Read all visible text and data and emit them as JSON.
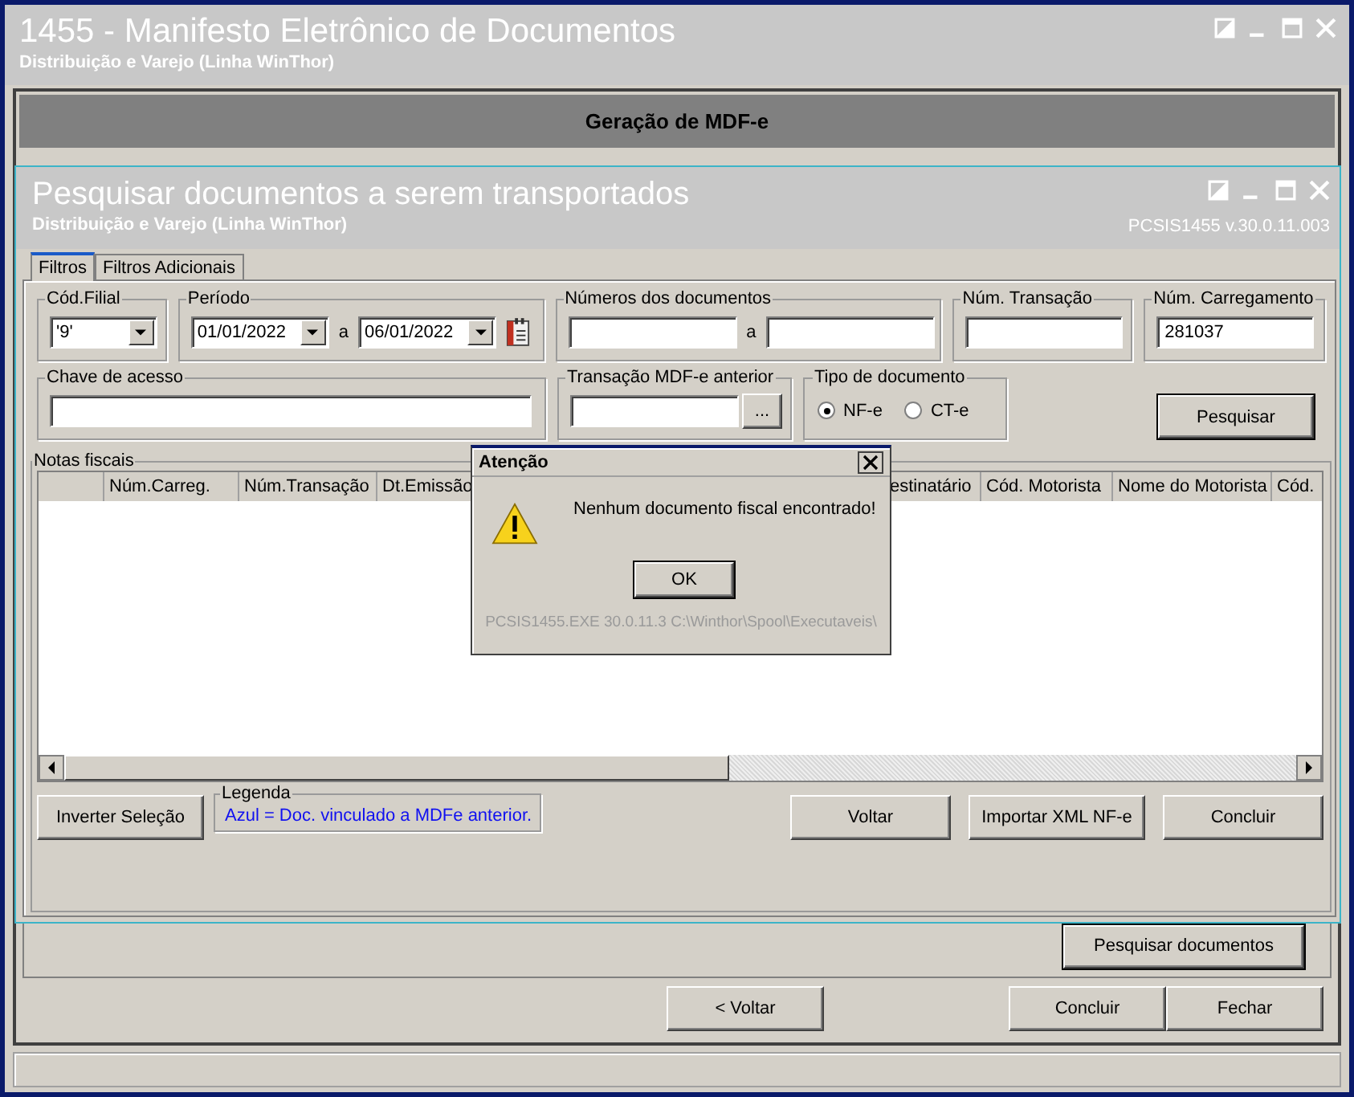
{
  "main_window": {
    "title": "1455 - Manifesto Eletrônico de Documentos",
    "subtitle": "Distribuição e Varejo (Linha WinThor)",
    "header": "Geração de MDF-e",
    "search_button": "Pesquisar documentos",
    "buttons": [
      "< Voltar",
      "Concluir",
      "Fechar"
    ]
  },
  "search_window": {
    "title": "Pesquisar documentos a serem transportados",
    "subtitle": "Distribuição e Varejo (Linha WinThor)",
    "version": "PCSIS1455  v.30.0.11.003",
    "tabs": [
      {
        "label": "Filtros",
        "selected": true
      },
      {
        "label": "Filtros Adicionais",
        "selected": false
      }
    ],
    "filters": {
      "branch": {
        "label": "Cód.Filial",
        "value": "'9'"
      },
      "period": {
        "label": "Período",
        "from": "01/01/2022",
        "separator": "a",
        "to": "06/01/2022"
      },
      "document_numbers": {
        "label": "Números dos documentos",
        "separator": "a"
      },
      "transaction": {
        "label": "Núm. Transação"
      },
      "loading": {
        "label": "Núm. Carregamento",
        "value": "281037"
      },
      "access_key": {
        "label": "Chave de acesso"
      },
      "previous_transaction": {
        "label": "Transação MDF-e anterior",
        "button": "..."
      },
      "document_type": {
        "label": "Tipo de documento",
        "options": [
          {
            "label": "NF-e",
            "selected": true
          },
          {
            "label": "CT-e",
            "selected": false
          }
        ]
      },
      "search_button": "Pesquisar"
    },
    "invoices": {
      "label": "Notas fiscais",
      "columns": [
        "Núm.Carreg.",
        "Núm.Transação",
        "Dt.Emissão",
        "estinatário",
        "Cód. Motorista",
        "Nome do Motorista",
        "Cód."
      ]
    },
    "legend": {
      "label": "Legenda",
      "text": "Azul = Doc. vinculado a MDFe anterior."
    },
    "buttons": [
      "Inverter Seleção",
      "Voltar",
      "Importar XML NF-e",
      "Concluir"
    ]
  },
  "dialog": {
    "title": "Atenção",
    "message": "Nenhum documento fiscal encontrado!",
    "button": "OK",
    "footer": "PCSIS1455.EXE 30.0.11.3 C:\\Winthor\\Spool\\Executaveis\\"
  }
}
